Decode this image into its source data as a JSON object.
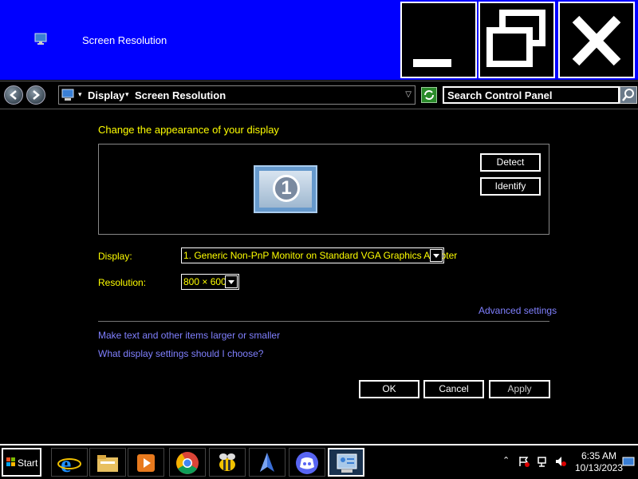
{
  "window": {
    "title": "Screen Resolution",
    "title_icon": "display-settings-icon"
  },
  "caption_buttons": {
    "minimize": "minimize-icon",
    "maximize": "restore-icon",
    "close": "close-icon"
  },
  "address_bar": {
    "crumbs": [
      "Display",
      "Screen Resolution"
    ],
    "search_placeholder": "Search Control Panel"
  },
  "content": {
    "heading": "Change the appearance of your display",
    "monitor_number": "1",
    "detect_label": "Detect",
    "identify_label": "Identify",
    "display_label": "Display:",
    "display_value": "1. Generic Non-PnP Monitor on Standard VGA Graphics Adapter",
    "resolution_label": "Resolution:",
    "resolution_value": "800 × 600",
    "advanced_link": "Advanced settings",
    "links": [
      "Make text and other items larger or smaller",
      "What display settings should I choose?"
    ],
    "ok_label": "OK",
    "cancel_label": "Cancel",
    "apply_label": "Apply"
  },
  "taskbar": {
    "start_label": "Start",
    "apps": [
      "internet-explorer-icon",
      "file-explorer-icon",
      "media-player-icon",
      "chrome-icon",
      "bee-app-icon",
      "blue-app-icon",
      "discord-icon",
      "control-panel-icon"
    ],
    "time": "6:35 AM",
    "date": "10/13/2023"
  },
  "colors": {
    "titlebar": "#0000ff",
    "heading": "#ffff00",
    "link": "#8080ff",
    "background": "#000000"
  }
}
